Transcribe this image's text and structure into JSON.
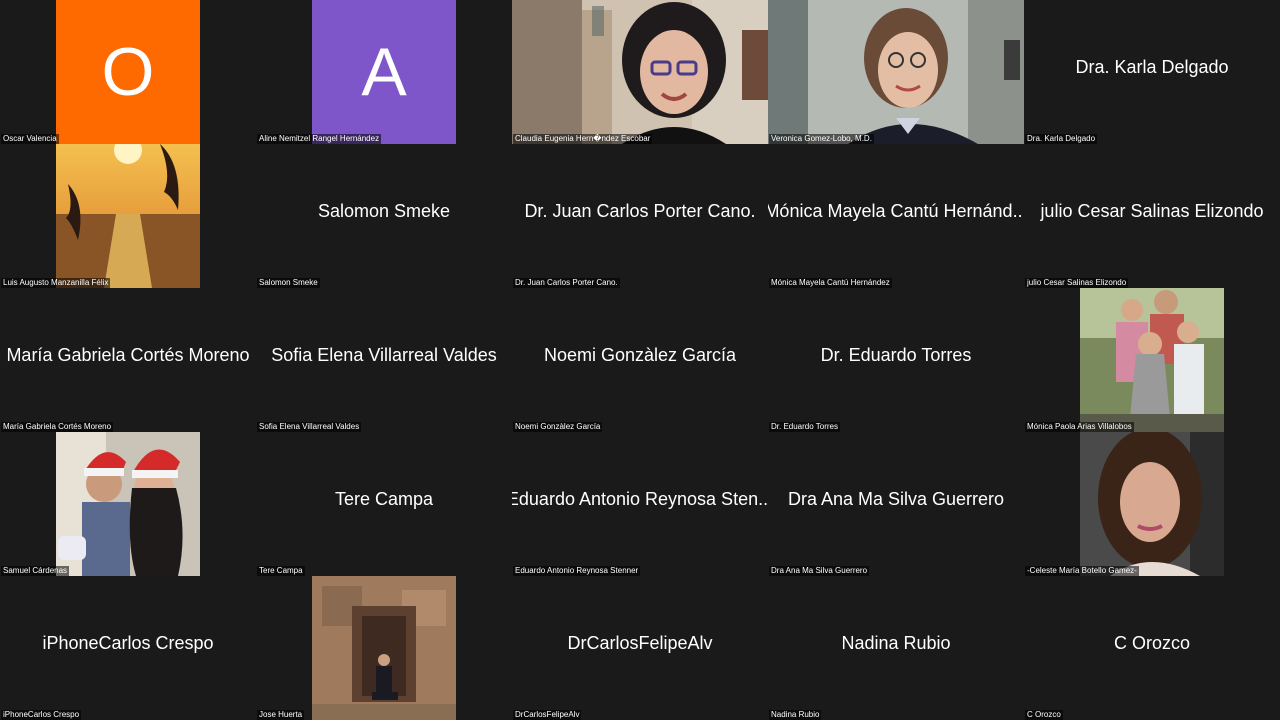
{
  "colors": {
    "background": "#1a1a1a",
    "avatar_orange": "#ff6a00",
    "avatar_purple": "#7f56c9"
  },
  "tiles": [
    {
      "label": "Oscar Valencia",
      "avatar_letter": "O"
    },
    {
      "label": "Aline Nemitzel Rangel Hernández",
      "avatar_letter": "A"
    },
    {
      "label": "Claudia Eugenia Hern�ndez Escobar"
    },
    {
      "label": "Veronica Gomez-Lobo, M.D."
    },
    {
      "label": "Dra. Karla Delgado",
      "name": "Dra. Karla Delgado"
    },
    {
      "label": "Luis Augusto Manzanilla Félix"
    },
    {
      "label": "Salomon Smeke",
      "name": "Salomon Smeke"
    },
    {
      "label": "Dr. Juan Carlos Porter Cano.",
      "name": "Dr. Juan Carlos Porter Cano."
    },
    {
      "label": "Mónica Mayela Cantú Hernández",
      "name": "Mónica Mayela Cantú Hernánd..."
    },
    {
      "label": "julio Cesar Salinas Elizondo",
      "name": "julio Cesar Salinas Elizondo"
    },
    {
      "label": "María Gabriela Cortés Moreno",
      "name": "María Gabriela Cortés Moreno"
    },
    {
      "label": "Sofia Elena Villarreal Valdes",
      "name": "Sofia Elena Villarreal Valdes"
    },
    {
      "label": "Noemi Gonzàlez García",
      "name": "Noemi Gonzàlez García"
    },
    {
      "label": "Dr. Eduardo Torres",
      "name": "Dr. Eduardo Torres"
    },
    {
      "label": "Mónica Paola Arias Villalobos"
    },
    {
      "label": "Samuel Cárdenas"
    },
    {
      "label": "Tere Campa",
      "name": "Tere Campa"
    },
    {
      "label": "Eduardo Antonio Reynosa Stenner",
      "name": "Eduardo Antonio Reynosa Sten..."
    },
    {
      "label": "Dra Ana Ma Silva Guerrero",
      "name": "Dra Ana Ma Silva Guerrero"
    },
    {
      "label": "-Celeste María Botello Gamez-"
    },
    {
      "label": "iPhoneCarlos Crespo",
      "name": "iPhoneCarlos Crespo"
    },
    {
      "label": "Jose Huerta"
    },
    {
      "label": "DrCarlosFelipeAlv",
      "name": "DrCarlosFelipeAlv"
    },
    {
      "label": "Nadina Rubio",
      "name": "Nadina Rubio"
    },
    {
      "label": "C Orozco",
      "name": "C Orozco"
    }
  ]
}
